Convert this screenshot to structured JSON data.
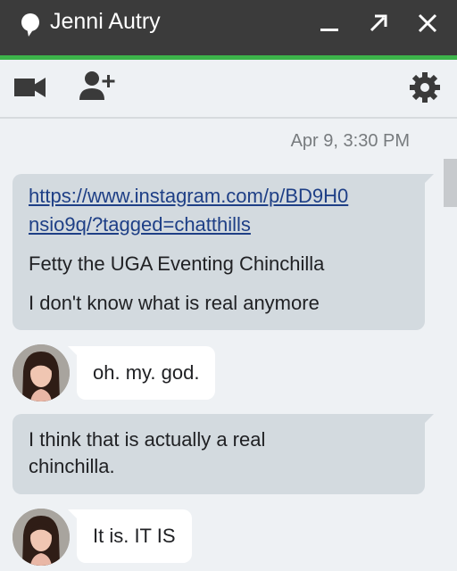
{
  "header": {
    "title": "Jenni Autry",
    "icons": [
      "chat-bubble-icon",
      "minimize-icon",
      "popout-icon",
      "close-icon"
    ],
    "accent_color": "#3cb44a"
  },
  "toolbar": {
    "icons": [
      "video-call-icon",
      "add-person-icon",
      "settings-gear-icon"
    ]
  },
  "conversation": {
    "timestamp": "Apr 9, 3:30 PM",
    "messages": [
      {
        "from": "me",
        "link_line1": "https://www.instagram.com/p/BD9H0",
        "link_line2": "nsio9q/?tagged=chatthills",
        "text1": "Fetty the UGA Eventing Chinchilla",
        "text2": "I don't know what is real anymore"
      },
      {
        "from": "contact",
        "text": "oh. my. god."
      },
      {
        "from": "me",
        "line1": "I think that is actually a real",
        "line2": "chinchilla."
      },
      {
        "from": "contact",
        "text": "It is. IT IS"
      }
    ]
  }
}
